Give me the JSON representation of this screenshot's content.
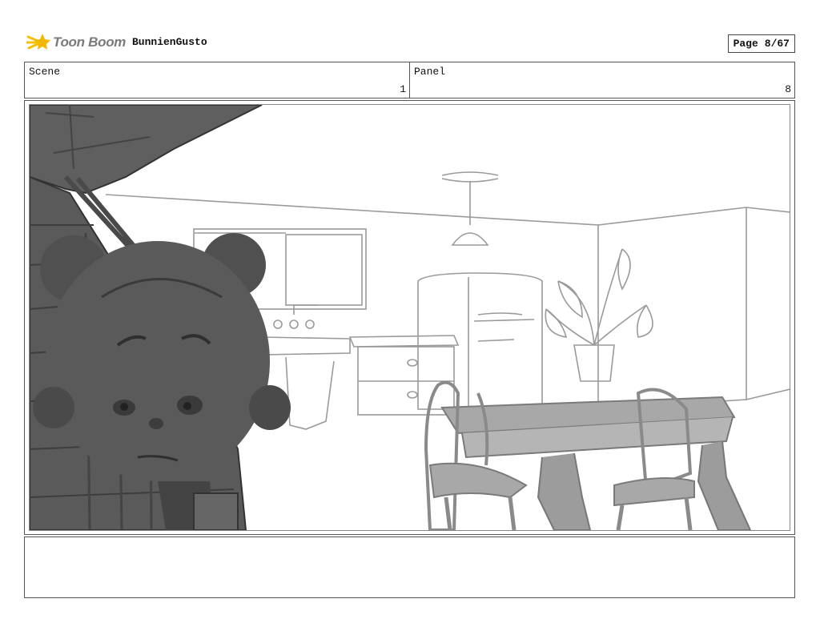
{
  "header": {
    "logo_text": "Toon Boom",
    "project_name": "BunnienGusto",
    "page_label": "Page",
    "page_number": "8/67"
  },
  "scene": {
    "label": "Scene",
    "value": "1"
  },
  "panel": {
    "label": "Panel",
    "value": "8"
  },
  "notes": {
    "text": ""
  },
  "colors": {
    "border": "#555555",
    "sketch_line": "#9a9a9a",
    "character_fill": "#5a5a5a",
    "furniture_fill": "#a8a8a8"
  }
}
